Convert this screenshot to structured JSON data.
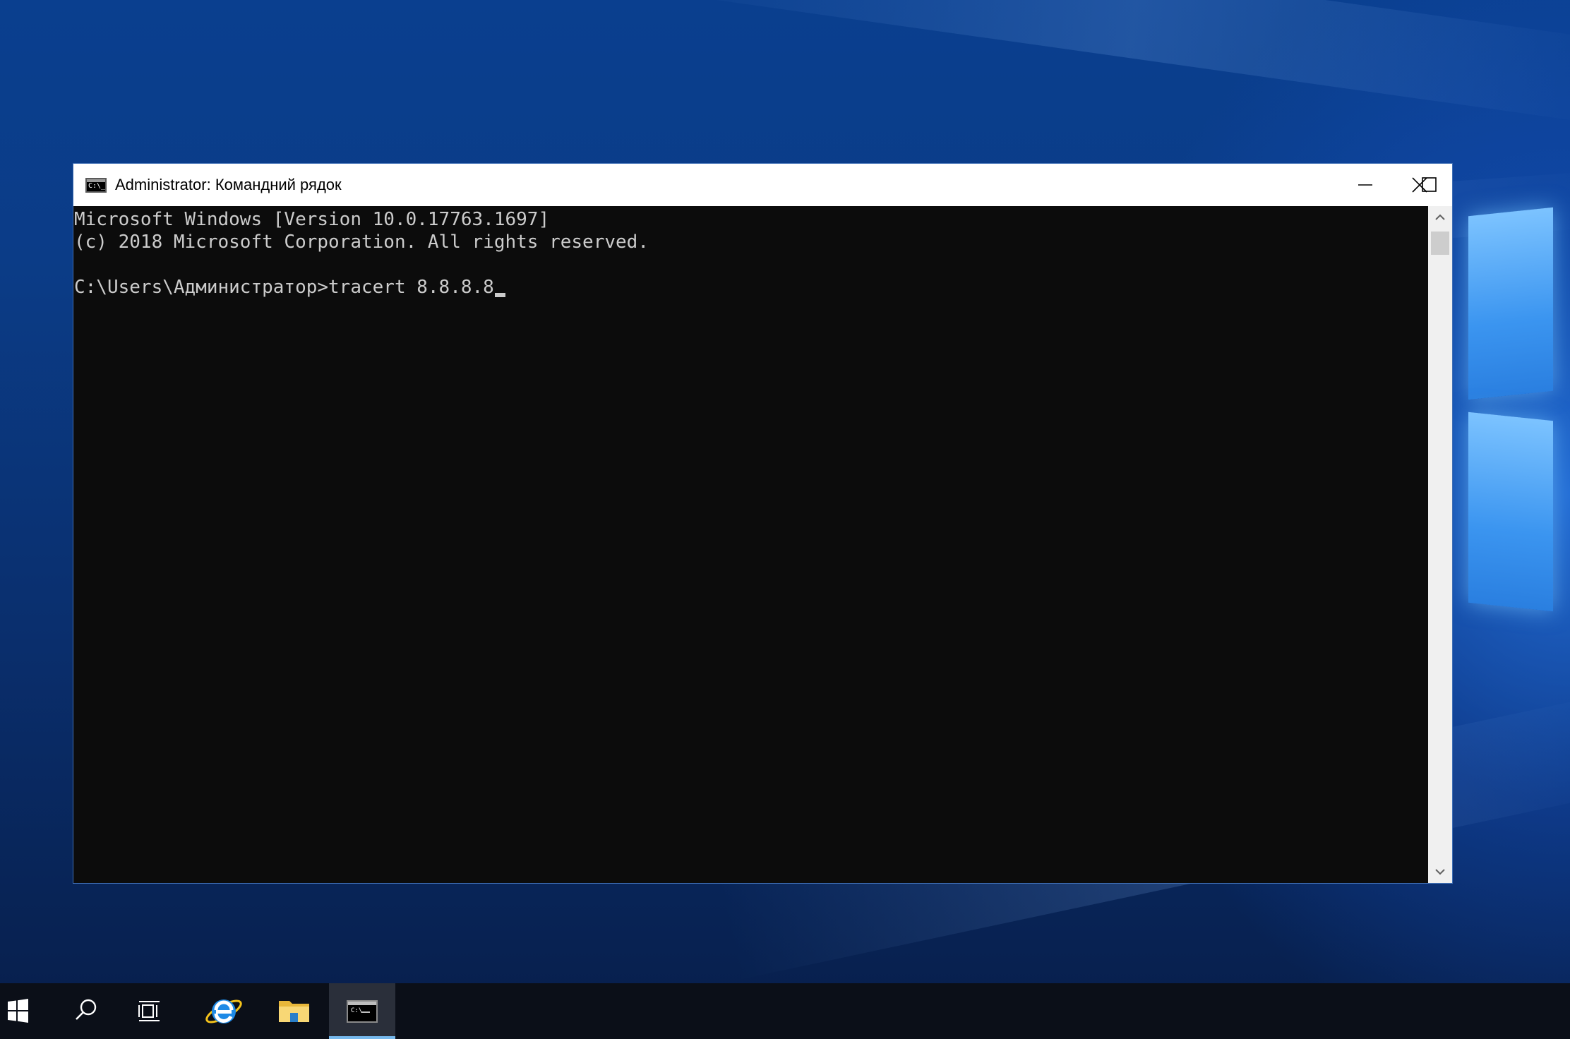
{
  "window": {
    "title": "Administrator: Командний рядок",
    "icon": "cmd-icon"
  },
  "console": {
    "lines": [
      "Microsoft Windows [Version 10.0.17763.1697]",
      "(c) 2018 Microsoft Corporation. All rights reserved.",
      "",
      "C:\\Users\\Администратор>tracert 8.8.8.8"
    ]
  },
  "caption_buttons": {
    "minimize": "minimize-icon",
    "maximize": "maximize-icon",
    "close": "close-icon"
  },
  "taskbar": {
    "items": [
      {
        "name": "start",
        "icon": "windows-start-icon"
      },
      {
        "name": "search",
        "icon": "search-icon"
      },
      {
        "name": "task-view",
        "icon": "task-view-icon"
      },
      {
        "name": "internet-explorer",
        "icon": "internet-explorer-icon"
      },
      {
        "name": "file-explorer",
        "icon": "folder-icon"
      },
      {
        "name": "command-prompt",
        "icon": "cmd-icon",
        "active": true
      }
    ]
  },
  "colors": {
    "console_bg": "#0c0c0c",
    "console_text": "#cccccc",
    "taskbar_bg": "#0b0f18",
    "accent": "#76b9ed"
  }
}
